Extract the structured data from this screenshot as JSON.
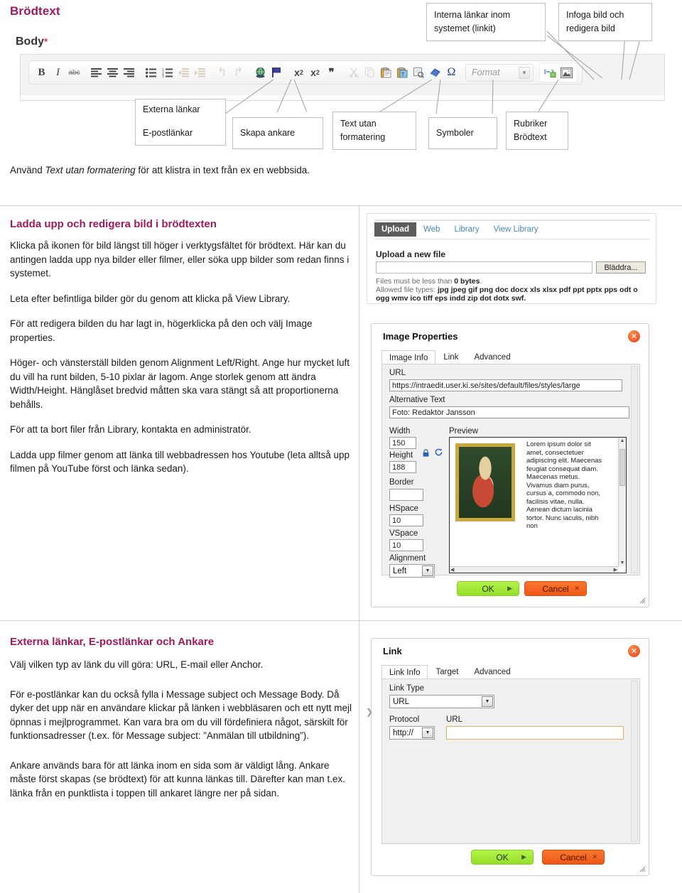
{
  "page": {
    "title": "Brödtext",
    "body_label": "Body",
    "required_mark": "*"
  },
  "toolbar": {
    "format_placeholder": "Format",
    "buttons": [
      {
        "name": "bold",
        "glyph": "B"
      },
      {
        "name": "italic",
        "glyph": "I"
      },
      {
        "name": "strikethrough",
        "glyph": "abc"
      },
      {
        "name": "align-left",
        "glyph": "≡"
      },
      {
        "name": "align-center",
        "glyph": "≡"
      },
      {
        "name": "align-right",
        "glyph": "≡"
      },
      {
        "name": "bulleted-list",
        "glyph": "•≡"
      },
      {
        "name": "numbered-list",
        "glyph": "1≡"
      },
      {
        "name": "outdent",
        "glyph": "◂≡"
      },
      {
        "name": "indent",
        "glyph": "▸≡"
      },
      {
        "name": "undo",
        "glyph": "↶"
      },
      {
        "name": "redo",
        "glyph": "↷"
      },
      {
        "name": "external-link",
        "glyph": "🌐"
      },
      {
        "name": "anchor-flag",
        "glyph": "⚑"
      },
      {
        "name": "superscript",
        "glyph": "x²"
      },
      {
        "name": "subscript",
        "glyph": "x₂"
      },
      {
        "name": "blockquote",
        "glyph": "❞"
      },
      {
        "name": "cut",
        "glyph": "✂"
      },
      {
        "name": "copy",
        "glyph": "❐"
      },
      {
        "name": "paste",
        "glyph": "📋"
      },
      {
        "name": "paste-plain-text",
        "glyph": "📋"
      },
      {
        "name": "paste-from-word",
        "glyph": "🔍"
      },
      {
        "name": "remove-format",
        "glyph": "◧"
      },
      {
        "name": "insert-special-character",
        "glyph": "Ω"
      },
      {
        "name": "internal-link",
        "glyph": "🔗"
      },
      {
        "name": "insert-image",
        "glyph": "🖼"
      }
    ]
  },
  "callouts": [
    {
      "id": "interna-lankar",
      "lines": [
        "Interna länkar inom",
        "systemet (linkit)"
      ]
    },
    {
      "id": "infoga-bild",
      "lines": [
        "Infoga bild och",
        "redigera bild"
      ]
    },
    {
      "id": "externa-lankar",
      "lines": [
        "Externa länkar",
        "E-postlänkar"
      ]
    },
    {
      "id": "skapa-ankare",
      "lines": [
        "Skapa ankare"
      ]
    },
    {
      "id": "text-utan-formatering",
      "lines": [
        "Text utan",
        "formatering"
      ]
    },
    {
      "id": "symboler",
      "lines": [
        "Symboler"
      ]
    },
    {
      "id": "rubriker",
      "lines": [
        "Rubriker",
        "Brödtext"
      ]
    }
  ],
  "use_note": {
    "before": "Använd ",
    "italic": "Text utan formatering",
    "after": " för att klistra in text från ex en webbsida."
  },
  "section_image": {
    "heading": "Ladda upp och redigera bild i brödtexten",
    "paragraphs": [
      "Klicka på ikonen för bild längst till höger i verktygsfältet för brödtext. Här kan du antingen ladda upp nya bilder eller filmer, eller söka upp bilder som redan finns i systemet.",
      "Leta efter befintliga bilder gör du genom att klicka på View Library.",
      "För att redigera bilden du har lagt in, högerklicka på den och välj Image properties.",
      "Höger- och vänsterställ bilden genom Alignment Left/Right. Ange hur mycket luft du vill ha runt bilden, 5-10 pixlar är lagom. Ange storlek genom att ändra Width/Height. Hänglåset bredvid måtten ska vara stängt så att proportionerna behålls.",
      "För att ta bort filer från Library, kontakta en administratör.",
      "Ladda upp filmer genom att länka till webbadressen hos Youtube (leta alltså upp filmen på YouTube först och länka sedan)."
    ]
  },
  "section_links": {
    "heading": "Externa länkar, E-postlänkar och Ankare",
    "paragraphs": [
      "Välj vilken typ av länk du vill göra: URL, E-mail eller Anchor.",
      "För e-postlänkar kan du också fylla i Message subject och Message Body. Då dyker det upp när en användare klickar på länken i webbläsaren och ett nytt mejl öpnnas i mejlprogrammet. Kan vara bra om du vill fördefiniera något, särskilt för funktionsadresser (t.ex. för Message subject: ”Anmälan till utbildning”).",
      "Ankare används bara för att länka inom en sida som är väldigt lång. Ankare måste först skapas (se brödtext) för att kunna länkas till. Därefter kan man t.ex. länka från en punktlista i toppen till ankaret längre ner på sidan."
    ]
  },
  "upload_dialog": {
    "tabs": [
      "Upload",
      "Web",
      "Library",
      "View Library"
    ],
    "active_tab": "Upload",
    "heading": "Upload a new file",
    "file_input_value": "",
    "browse_label": "Bläddra...",
    "size_note_prefix": "Files must be less than ",
    "size_note_value": "0 bytes",
    "size_note_suffix": ".",
    "types_label": "Allowed file types:",
    "types_value": "jpg jpeg gif png doc docx xls xlsx pdf ppt pptx pps odt o ogg wmv ico tiff eps indd zip dot dotx swf."
  },
  "image_properties_dialog": {
    "title": "Image Properties",
    "close_glyph": "✕",
    "tabs": [
      "Image Info",
      "Link",
      "Advanced"
    ],
    "active_tab": "Image Info",
    "fields": {
      "url_label": "URL",
      "url_value": "https://intraedit.user.ki.se/sites/default/files/styles/large",
      "alt_label": "Alternative Text",
      "alt_value": "Foto: Redaktör Jansson",
      "width_label": "Width",
      "width_value": "150",
      "height_label": "Height",
      "height_value": "188",
      "border_label": "Border",
      "border_value": "",
      "hspace_label": "HSpace",
      "hspace_value": "10",
      "vspace_label": "VSpace",
      "vspace_value": "10",
      "alignment_label": "Alignment",
      "alignment_value": "Left",
      "preview_label": "Preview",
      "preview_text": "Lorem ipsum dolor sit amet, consectetuer adipiscing elit. Maecenas feugiat consequat diam. Maecenas metus. Vivamus diam purus, cursus a, commodo non, facilisis vitae, nulla. Aenean dictum lacinia tortor. Nunc iaculis, nibh non"
    },
    "lock_icon": "lock",
    "reset_icon": "reset",
    "ok_label": "OK",
    "cancel_label": "Cancel"
  },
  "link_dialog": {
    "title": "Link",
    "close_glyph": "✕",
    "tabs": [
      "Link Info",
      "Target",
      "Advanced"
    ],
    "active_tab": "Link Info",
    "fields": {
      "link_type_label": "Link Type",
      "link_type_value": "URL",
      "protocol_label": "Protocol",
      "protocol_value": "http://",
      "url_label": "URL",
      "url_value": ""
    },
    "ok_label": "OK",
    "cancel_label": "Cancel"
  },
  "colors": {
    "heading": "#9e1a5a",
    "ok_button": "#93e026",
    "cancel_button": "#ef5816",
    "link_blue": "#4a87b5"
  }
}
